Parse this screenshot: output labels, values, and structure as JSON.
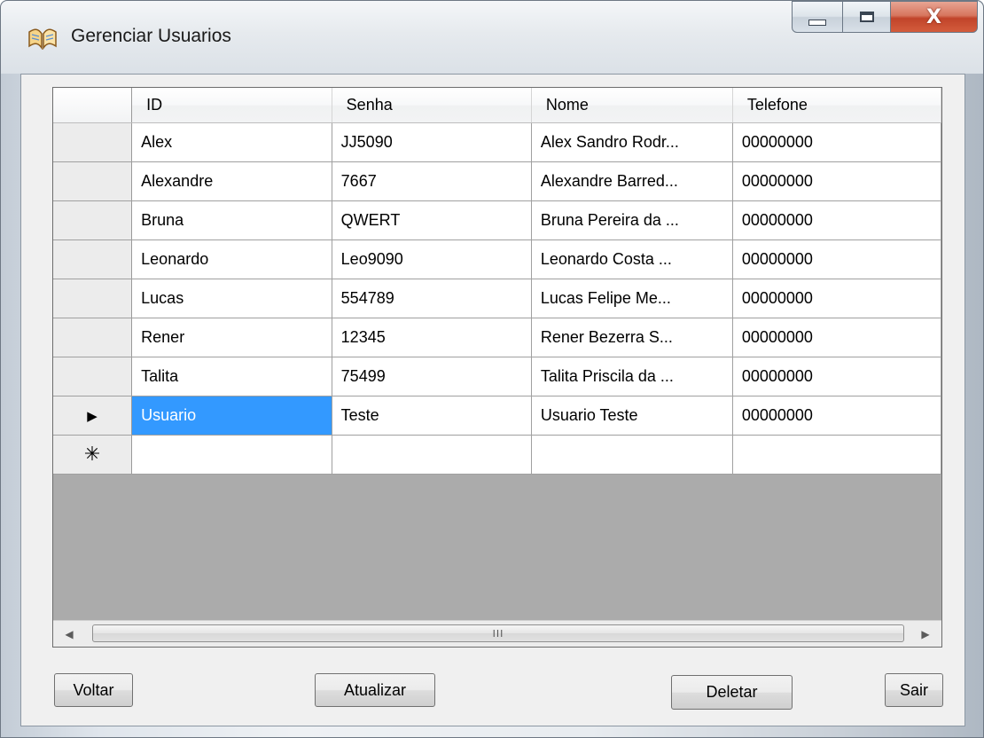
{
  "window": {
    "title": "Gerenciar Usuarios",
    "close_glyph": "X"
  },
  "grid": {
    "columns": [
      "ID",
      "Senha",
      "Nome",
      "Telefone"
    ],
    "rows": [
      {
        "id": "Alex",
        "senha": "JJ5090",
        "nome": "Alex Sandro Rodr...",
        "telefone": "00000000"
      },
      {
        "id": "Alexandre",
        "senha": "7667",
        "nome": "Alexandre Barred...",
        "telefone": "00000000"
      },
      {
        "id": "Bruna",
        "senha": "QWERT",
        "nome": "Bruna Pereira da ...",
        "telefone": "00000000"
      },
      {
        "id": "Leonardo",
        "senha": "Leo9090",
        "nome": "Leonardo Costa ...",
        "telefone": "00000000"
      },
      {
        "id": "Lucas",
        "senha": "554789",
        "nome": "Lucas Felipe Me...",
        "telefone": "00000000"
      },
      {
        "id": "Rener",
        "senha": "12345",
        "nome": "Rener Bezerra S...",
        "telefone": "00000000"
      },
      {
        "id": "Talita",
        "senha": "75499",
        "nome": "Talita Priscila da ...",
        "telefone": "00000000"
      },
      {
        "id": "Usuario",
        "senha": "Teste",
        "nome": "Usuario Teste",
        "telefone": "00000000"
      }
    ],
    "current_row_marker": "▶",
    "new_row_marker": "✳",
    "selected_row": 7,
    "selected_color": "#3399ff"
  },
  "scrollbar": {
    "left_arrow": "◀",
    "right_arrow": "▶",
    "grip": "III"
  },
  "buttons": {
    "voltar": "Voltar",
    "atualizar": "Atualizar",
    "deletar": "Deletar",
    "sair": "Sair"
  }
}
